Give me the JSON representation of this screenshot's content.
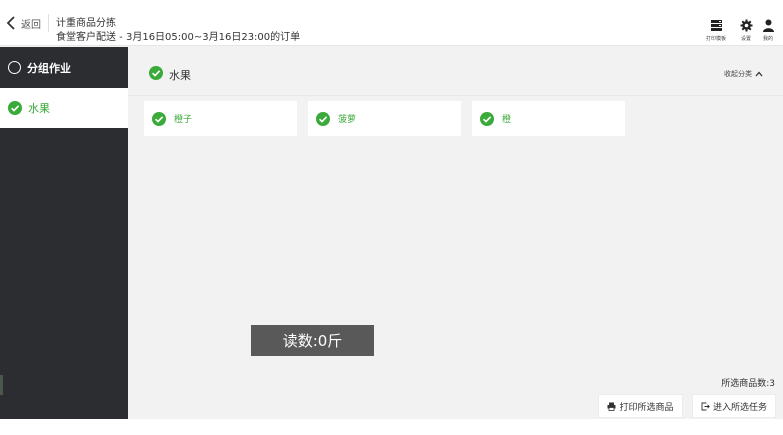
{
  "header": {
    "back_label": "返回",
    "title": "计重商品分拣",
    "subtitle": "食堂客户配送 - 3月16日05:00~3月16日23:00的订单",
    "tools": [
      {
        "label": "打印模板",
        "icon": "printer-icon"
      },
      {
        "label": "设置",
        "icon": "gear-icon"
      },
      {
        "label": "我的",
        "icon": "user-icon"
      }
    ]
  },
  "sidebar": {
    "items": [
      {
        "label": "分组作业",
        "icon": "circle-icon",
        "active": false
      },
      {
        "label": "水果",
        "icon": "check-circle-icon",
        "active": true
      }
    ]
  },
  "main": {
    "section_title": "水果",
    "collapse_label": "收起分类",
    "products": [
      {
        "name": "橙子",
        "checked": true
      },
      {
        "name": "菠萝",
        "checked": true
      },
      {
        "name": "橙",
        "checked": true
      }
    ],
    "reading": "读数:0斤",
    "selected_count": "所选商品数:3",
    "print_button": "打印所选商品",
    "enter_button": "进入所选任务"
  },
  "colors": {
    "accent_green": "#3aaa3a",
    "sidebar_bg": "#2b2d31",
    "content_bg": "#f2f2f2",
    "reading_bg": "#595959"
  }
}
